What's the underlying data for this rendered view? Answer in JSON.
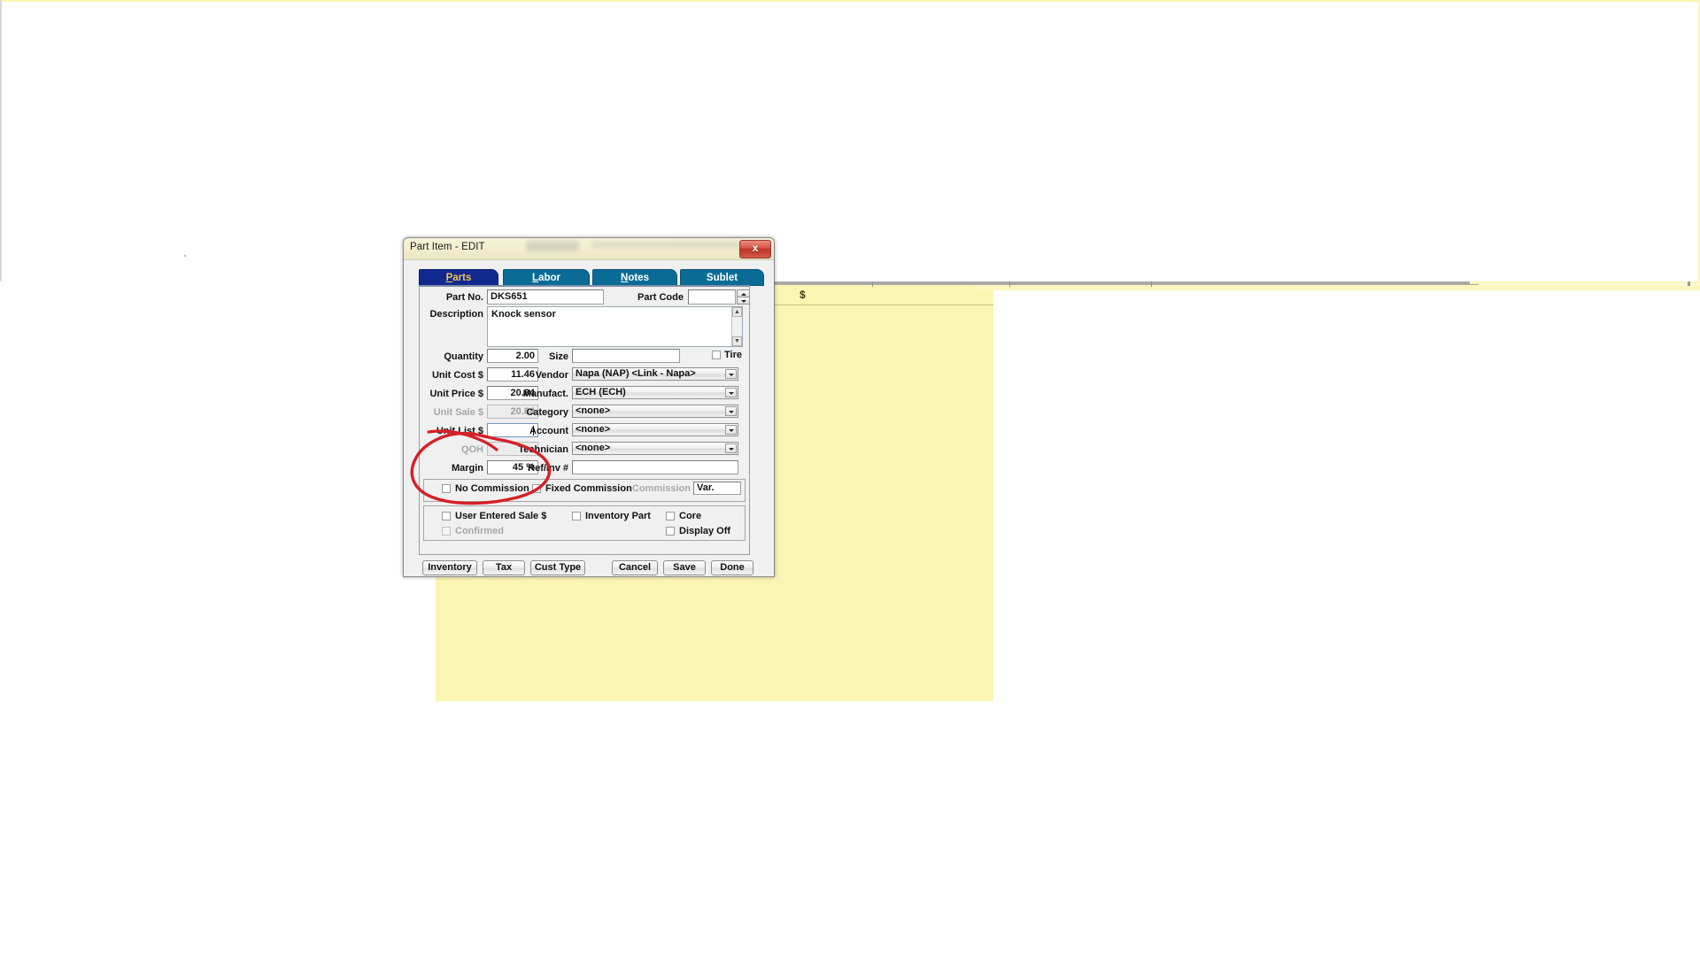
{
  "background": {
    "dollar_marker": "$"
  },
  "window": {
    "title": "Part Item - EDIT",
    "close_label": "x"
  },
  "tabs": [
    {
      "label": "Parts",
      "accel": "P",
      "rest": "arts",
      "active": true
    },
    {
      "label": "Labor",
      "accel": "L",
      "rest": "abor",
      "active": false
    },
    {
      "label": "Notes",
      "accel": "N",
      "rest": "otes",
      "active": false
    },
    {
      "label": "Sublet",
      "accel": "",
      "rest": "Sublet",
      "active": false
    }
  ],
  "form": {
    "part_no_label": "Part No.",
    "part_no_value": "DKS651",
    "part_code_label": "Part Code",
    "part_code_value": "",
    "description_label": "Description",
    "description_value": "Knock sensor",
    "quantity_label": "Quantity",
    "quantity_value": "2.00",
    "unit_cost_label": "Unit Cost $",
    "unit_cost_value": "11.46",
    "unit_price_label": "Unit Price $",
    "unit_price_value": "20.84",
    "unit_sale_label": "Unit Sale $",
    "unit_sale_value": "20.84",
    "unit_list_label": "Unit List $",
    "unit_list_value": "",
    "qoh_label": "QOH",
    "qoh_value": "",
    "margin_label": "Margin",
    "margin_value": "45 %",
    "size_label": "Size",
    "size_value": "",
    "tire_label": "Tire",
    "vendor_label": "Vendor",
    "vendor_value": "Napa (NAP) <Link - Napa>",
    "manufact_label": "Manufact.",
    "manufact_value": "ECH (ECH)",
    "category_label": "Category",
    "category_value": "<none>",
    "account_label": "Account",
    "account_value": "<none>",
    "technician_label": "Technician",
    "technician_value": "<none>",
    "refinv_label": "Ref/Inv #",
    "refinv_value": ""
  },
  "commission_group": {
    "no_commission_label": "No Commission",
    "fixed_commission_label": "Fixed Commission",
    "commission_amount_label": "Commission $",
    "commission_amount_value": "Var."
  },
  "options_group": {
    "user_entered_sale_label": "User Entered Sale $",
    "inventory_part_label": "Inventory Part",
    "core_label": "Core",
    "confirmed_label": "Confirmed",
    "display_off_label": "Display Off"
  },
  "buttons": {
    "inventory": "Inventory",
    "tax": "Tax",
    "cust_type": "Cust Type",
    "cancel": "Cancel",
    "save": "Save",
    "done": "Done"
  },
  "annotation": {
    "ink_color": "#d61f26",
    "shape": "hand-drawn-red-ellipse"
  }
}
